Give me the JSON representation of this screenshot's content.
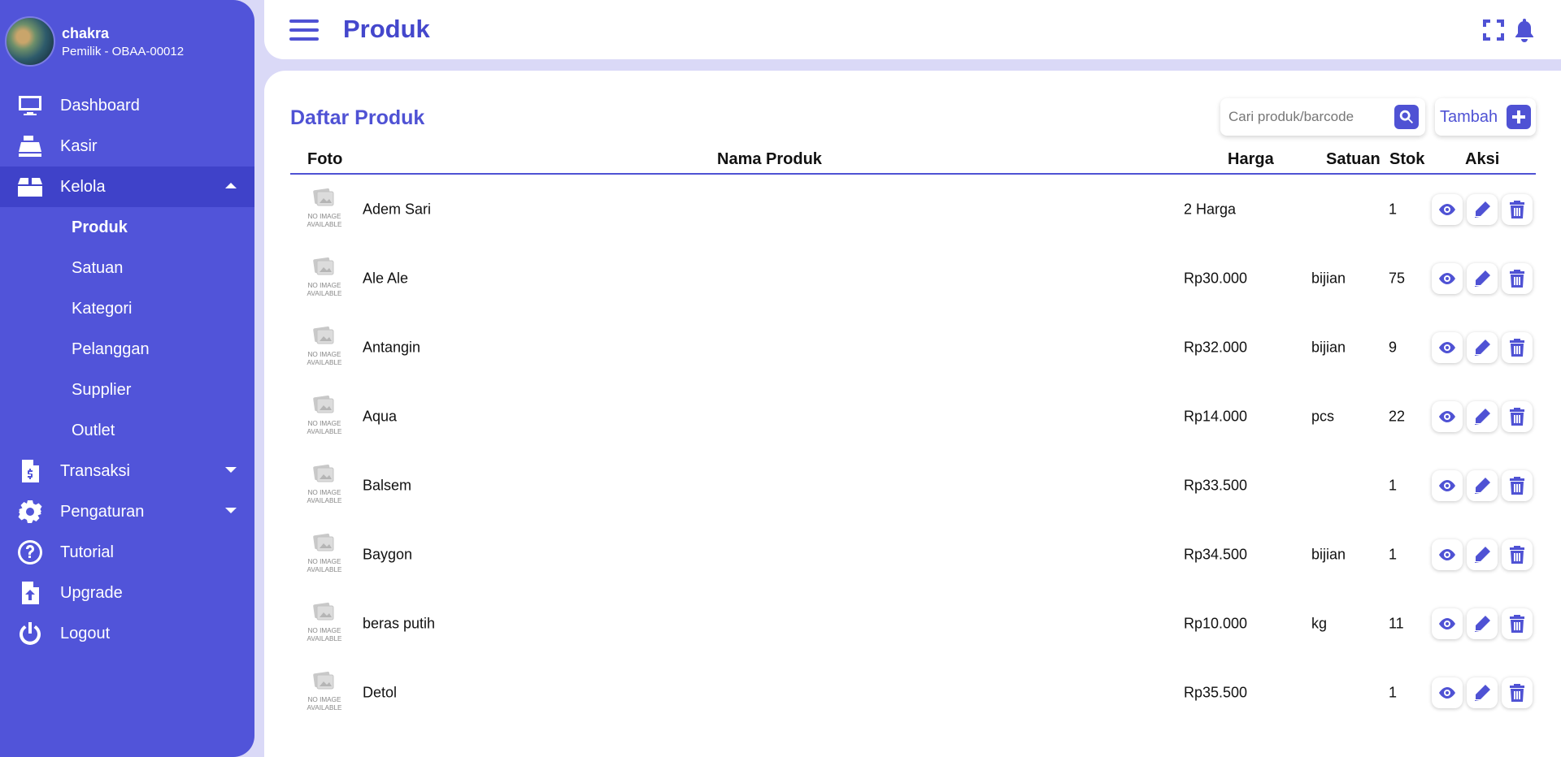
{
  "user": {
    "name": "chakra",
    "role": "Pemilik - OBAA-00012"
  },
  "nav": [
    {
      "label": "Dashboard",
      "icon": "monitor-icon"
    },
    {
      "label": "Kasir",
      "icon": "cash-register-icon"
    },
    {
      "label": "Kelola",
      "icon": "box-icon",
      "active": true,
      "expanded": true
    },
    {
      "label": "Transaksi",
      "icon": "file-invoice-dollar-icon"
    },
    {
      "label": "Pengaturan",
      "icon": "gear-icon"
    },
    {
      "label": "Tutorial",
      "icon": "question-circle-icon"
    },
    {
      "label": "Upgrade",
      "icon": "file-upload-icon"
    },
    {
      "label": "Logout",
      "icon": "power-icon"
    }
  ],
  "kelola_sub": [
    "Produk",
    "Satuan",
    "Kategori",
    "Pelanggan",
    "Supplier",
    "Outlet"
  ],
  "header": {
    "title": "Produk"
  },
  "main": {
    "title": "Daftar Produk",
    "search_placeholder": "Cari produk/barcode",
    "add_label": "Tambah"
  },
  "table": {
    "columns": {
      "foto": "Foto",
      "nama": "Nama Produk",
      "harga": "Harga",
      "satuan": "Satuan",
      "stok": "Stok",
      "aksi": "Aksi"
    },
    "no_image_text": [
      "NO IMAGE",
      "AVAILABLE"
    ],
    "rows": [
      {
        "nama": "Adem Sari",
        "harga": "2 Harga",
        "satuan": "",
        "stok": "1"
      },
      {
        "nama": "Ale Ale",
        "harga": "Rp30.000",
        "satuan": "bijian",
        "stok": "75"
      },
      {
        "nama": "Antangin",
        "harga": "Rp32.000",
        "satuan": "bijian",
        "stok": "9"
      },
      {
        "nama": "Aqua",
        "harga": "Rp14.000",
        "satuan": "pcs",
        "stok": "22"
      },
      {
        "nama": "Balsem",
        "harga": "Rp33.500",
        "satuan": "",
        "stok": "1"
      },
      {
        "nama": "Baygon",
        "harga": "Rp34.500",
        "satuan": "bijian",
        "stok": "1"
      },
      {
        "nama": "beras putih",
        "harga": "Rp10.000",
        "satuan": "kg",
        "stok": "11"
      },
      {
        "nama": "Detol",
        "harga": "Rp35.500",
        "satuan": "",
        "stok": "1"
      }
    ]
  },
  "colors": {
    "primary": "#5154d9",
    "accent": "#4f52d4",
    "background": "#dad9f7"
  }
}
